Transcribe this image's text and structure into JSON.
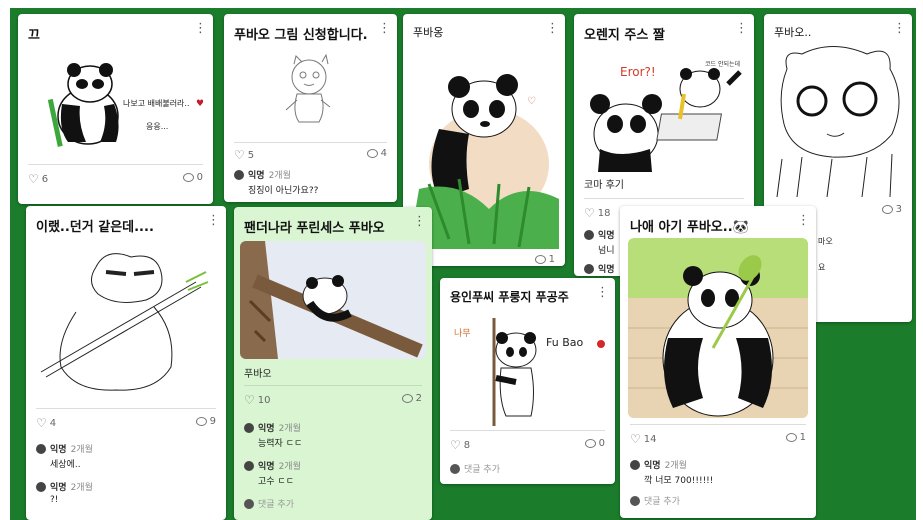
{
  "cards": [
    {
      "title": "끄",
      "like": "6",
      "comments": "0"
    },
    {
      "title": "푸바오 그림 신청합니다.",
      "like": "5",
      "comments": "4",
      "comment_list": [
        {
          "name": "익명",
          "time": "2개월",
          "text": "징징이 아닌가요??"
        }
      ]
    },
    {
      "title": "푸바옹",
      "like": "",
      "comments": "1"
    },
    {
      "title": "오렌지 주스 짤",
      "caption": "코마 후기",
      "like": "18",
      "comments": "",
      "comment_list": [
        {
          "name": "익명",
          "time": "",
          "text": "넘니"
        },
        {
          "name": "익명",
          "time": "",
          "text": ""
        }
      ],
      "img_text": {
        "error": "Eror?!",
        "note": "코드 안되는데"
      }
    },
    {
      "title": "푸바오..",
      "like": "",
      "comments": "3",
      "side_text": [
        "마오",
        "요"
      ]
    },
    {
      "title": "이랬..던거 같은데....",
      "like": "4",
      "comments": "9",
      "comment_list": [
        {
          "name": "익명",
          "time": "2개월",
          "text": "세상에.."
        },
        {
          "name": "익명",
          "time": "2개월",
          "text": "?!"
        }
      ]
    },
    {
      "title": "팬더나라 푸린세스 푸바오",
      "caption": "푸바오",
      "like": "10",
      "comments": "2",
      "comment_list": [
        {
          "name": "익명",
          "time": "2개월",
          "text": "능력자 ㄷㄷ"
        },
        {
          "name": "익명",
          "time": "2개월",
          "text": "고수 ㄷㄷ"
        }
      ],
      "add_comment": "댓글 추가"
    },
    {
      "title": "용인푸씨 푸룽지 푸공주",
      "like": "8",
      "comments": "0",
      "add_comment": "댓글 추가",
      "img_text": {
        "left": "나무",
        "right": "Fu Bao"
      }
    },
    {
      "title": "나애 아기 푸바오..🐼",
      "like": "14",
      "comments": "1",
      "comment_list": [
        {
          "name": "익명",
          "time": "2개월",
          "text": "깍 너모 700!!!!!!"
        }
      ],
      "add_comment": "댓글 추가"
    }
  ],
  "card0_img_text": [
    "나보고 배배불러라..",
    "응응..."
  ],
  "colors": {
    "board_bg": "#1b7d2b",
    "card_green": "#d9f5d2"
  }
}
